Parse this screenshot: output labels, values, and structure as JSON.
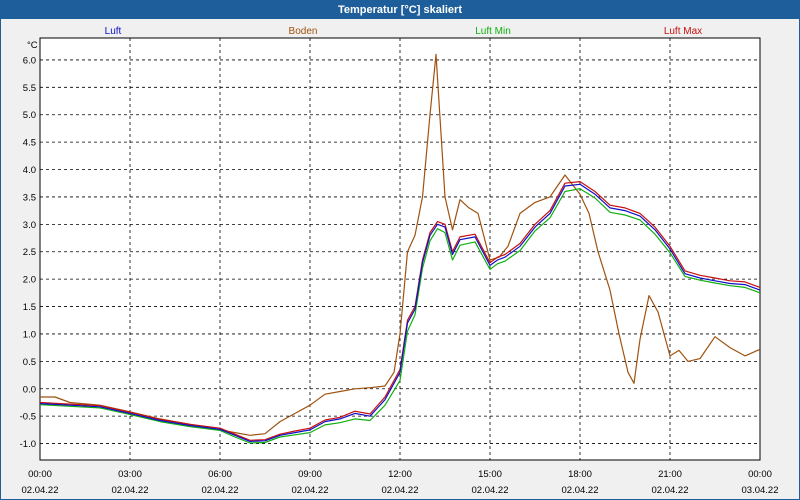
{
  "window": {
    "title": "Temperatur [°C] skaliert"
  },
  "chart_data": {
    "type": "line",
    "title": "Temperatur [°C] skaliert",
    "ylabel": "°C",
    "ylim": [
      -1.3,
      6.4
    ],
    "yticks": [
      "6.0",
      "5.5",
      "5.0",
      "4.5",
      "4.0",
      "3.5",
      "3.0",
      "2.5",
      "2.0",
      "1.5",
      "1.0",
      "0.5",
      "0.0",
      "-0.5",
      "-1.0"
    ],
    "ytick_values": [
      6.0,
      5.5,
      5.0,
      4.5,
      4.0,
      3.5,
      3.0,
      2.5,
      2.0,
      1.5,
      1.0,
      0.5,
      0.0,
      -0.5,
      -1.0
    ],
    "xlim": [
      0,
      24
    ],
    "xticks_time": [
      "00:00",
      "03:00",
      "06:00",
      "09:00",
      "12:00",
      "15:00",
      "18:00",
      "21:00",
      "00:00"
    ],
    "xticks_date": [
      "02.04.22",
      "02.04.22",
      "02.04.22",
      "02.04.22",
      "02.04.22",
      "02.04.22",
      "02.04.22",
      "02.04.22",
      "03.04.22"
    ],
    "grid": true,
    "legend_position": "top",
    "series": [
      {
        "name": "Luft",
        "color": "#1010c8",
        "x": [
          0,
          1,
          2,
          3,
          4,
          5,
          6,
          6.5,
          7,
          7.5,
          8,
          8.5,
          9,
          9.5,
          10,
          10.5,
          11,
          11.5,
          12,
          12.25,
          12.5,
          12.75,
          13,
          13.25,
          13.5,
          13.75,
          14,
          14.5,
          15,
          15.25,
          15.5,
          16,
          16.5,
          17,
          17.5,
          18,
          18.5,
          19,
          19.5,
          20,
          20.5,
          21,
          21.5,
          22,
          22.5,
          23,
          23.5,
          24
        ],
        "y": [
          -0.27,
          -0.3,
          -0.33,
          -0.45,
          -0.58,
          -0.67,
          -0.74,
          -0.85,
          -0.96,
          -0.95,
          -0.85,
          -0.8,
          -0.75,
          -0.6,
          -0.55,
          -0.45,
          -0.5,
          -0.2,
          0.3,
          1.2,
          1.45,
          2.3,
          2.8,
          3.0,
          2.95,
          2.45,
          2.72,
          2.77,
          2.25,
          2.35,
          2.4,
          2.6,
          2.95,
          3.2,
          3.7,
          3.73,
          3.55,
          3.3,
          3.25,
          3.15,
          2.9,
          2.55,
          2.1,
          2.02,
          1.97,
          1.92,
          1.9,
          1.8
        ]
      },
      {
        "name": "Boden",
        "color": "#a0520f",
        "x": [
          0,
          0.5,
          1,
          2,
          3,
          4,
          5,
          6,
          6.5,
          7,
          7.5,
          8,
          8.5,
          9,
          9.5,
          10,
          10.5,
          11,
          11.5,
          11.8,
          12,
          12.25,
          12.5,
          12.75,
          13,
          13.2,
          13.5,
          13.75,
          14,
          14.3,
          14.6,
          15,
          15.3,
          15.6,
          16,
          16.5,
          17,
          17.5,
          18,
          18.3,
          18.6,
          19,
          19.3,
          19.6,
          19.8,
          20,
          20.3,
          20.6,
          21,
          21.3,
          21.6,
          22,
          22.5,
          23,
          23.5,
          24
        ],
        "y": [
          -0.15,
          -0.15,
          -0.25,
          -0.3,
          -0.42,
          -0.55,
          -0.65,
          -0.75,
          -0.8,
          -0.85,
          -0.82,
          -0.6,
          -0.45,
          -0.3,
          -0.1,
          -0.05,
          0.0,
          0.02,
          0.05,
          0.3,
          1.0,
          2.5,
          2.8,
          3.5,
          5.0,
          6.1,
          3.5,
          2.9,
          3.45,
          3.3,
          3.2,
          2.35,
          2.4,
          2.6,
          3.2,
          3.4,
          3.5,
          3.9,
          3.55,
          3.2,
          2.5,
          1.8,
          1.0,
          0.3,
          0.1,
          0.9,
          1.7,
          1.4,
          0.6,
          0.7,
          0.5,
          0.55,
          0.95,
          0.75,
          0.6,
          0.72
        ]
      },
      {
        "name": "Luft Min",
        "color": "#10b010",
        "x": [
          0,
          1,
          2,
          3,
          4,
          5,
          6,
          6.5,
          7,
          7.5,
          8,
          8.5,
          9,
          9.5,
          10,
          10.5,
          11,
          11.5,
          12,
          12.25,
          12.5,
          12.75,
          13,
          13.25,
          13.5,
          13.75,
          14,
          14.5,
          15,
          15.25,
          15.5,
          16,
          16.5,
          17,
          17.5,
          18,
          18.5,
          19,
          19.5,
          20,
          20.5,
          21,
          21.5,
          22,
          22.5,
          23,
          23.5,
          24
        ],
        "y": [
          -0.29,
          -0.32,
          -0.35,
          -0.47,
          -0.6,
          -0.69,
          -0.76,
          -0.88,
          -0.99,
          -0.98,
          -0.88,
          -0.84,
          -0.8,
          -0.66,
          -0.62,
          -0.55,
          -0.58,
          -0.3,
          0.15,
          1.05,
          1.35,
          2.2,
          2.7,
          2.92,
          2.85,
          2.35,
          2.62,
          2.68,
          2.18,
          2.28,
          2.33,
          2.52,
          2.88,
          3.12,
          3.6,
          3.65,
          3.48,
          3.22,
          3.17,
          3.08,
          2.82,
          2.48,
          2.05,
          1.98,
          1.93,
          1.88,
          1.85,
          1.75
        ]
      },
      {
        "name": "Luft Max",
        "color": "#c81010",
        "x": [
          0,
          1,
          2,
          3,
          4,
          5,
          6,
          6.5,
          7,
          7.5,
          8,
          8.5,
          9,
          9.5,
          10,
          10.5,
          11,
          11.5,
          12,
          12.25,
          12.5,
          12.75,
          13,
          13.25,
          13.5,
          13.75,
          14,
          14.5,
          15,
          15.25,
          15.5,
          16,
          16.5,
          17,
          17.5,
          18,
          18.5,
          19,
          19.5,
          20,
          20.5,
          21,
          21.5,
          22,
          22.5,
          23,
          23.5,
          24
        ],
        "y": [
          -0.25,
          -0.28,
          -0.31,
          -0.43,
          -0.56,
          -0.65,
          -0.72,
          -0.83,
          -0.94,
          -0.93,
          -0.83,
          -0.77,
          -0.72,
          -0.57,
          -0.52,
          -0.41,
          -0.46,
          -0.15,
          0.35,
          1.25,
          1.5,
          2.35,
          2.85,
          3.05,
          3.0,
          2.5,
          2.77,
          2.82,
          2.3,
          2.4,
          2.45,
          2.65,
          3.0,
          3.25,
          3.75,
          3.78,
          3.6,
          3.35,
          3.3,
          3.2,
          2.95,
          2.6,
          2.15,
          2.07,
          2.02,
          1.97,
          1.95,
          1.85
        ]
      }
    ]
  }
}
